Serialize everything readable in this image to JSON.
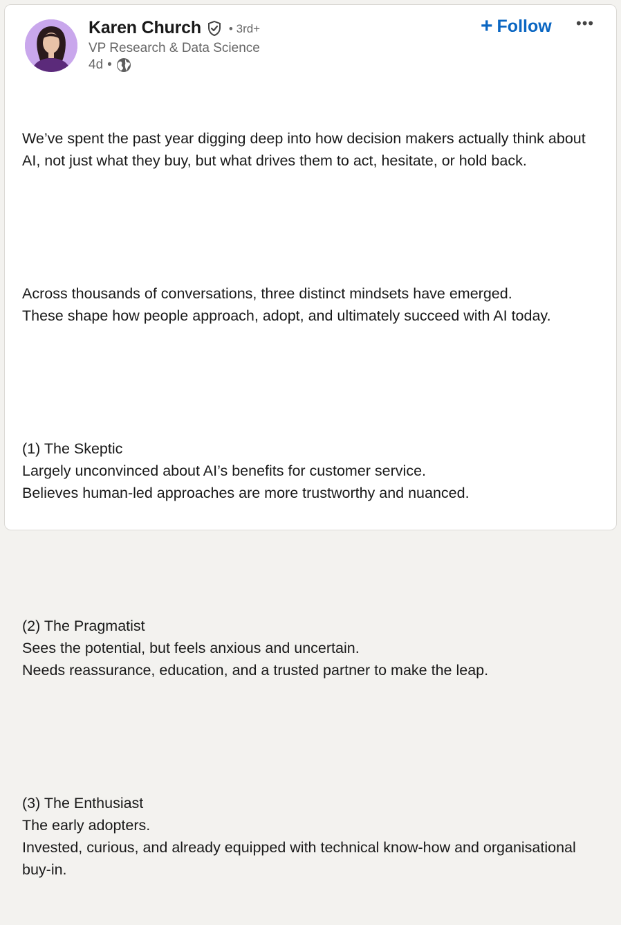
{
  "author": {
    "name": "Karen Church",
    "degree": "3rd+",
    "headline": "VP Research & Data Science",
    "time": "4d",
    "avatar_bg": "#c9a7ec",
    "verified_icon": "shield-check-icon",
    "visibility_icon": "globe-icon"
  },
  "actions": {
    "follow_label": "Follow",
    "more_icon": "more-horizontal-icon",
    "accent": "#0a66c2"
  },
  "post": {
    "paragraphs": [
      [
        "We’ve spent the past year digging deep into how decision makers actually think about AI, not just what they buy, but what drives them to act, hesitate, or hold back."
      ],
      [
        "Across thousands of conversations, three distinct mindsets have emerged.",
        "These shape how people approach, adopt, and ultimately succeed with AI today."
      ],
      [
        "(1) The Skeptic",
        "Largely unconvinced about AI’s benefits for customer service.",
        "Believes human-led approaches are more trustworthy and nuanced."
      ],
      [
        "(2) The Pragmatist",
        "Sees the potential, but feels anxious and uncertain.",
        "Needs reassurance, education, and a trusted partner to make the leap."
      ],
      [
        "(3) The Enthusiast",
        "The early adopters.",
        "Invested, curious, and already equipped with technical know-how and organisational buy-in."
      ]
    ]
  }
}
